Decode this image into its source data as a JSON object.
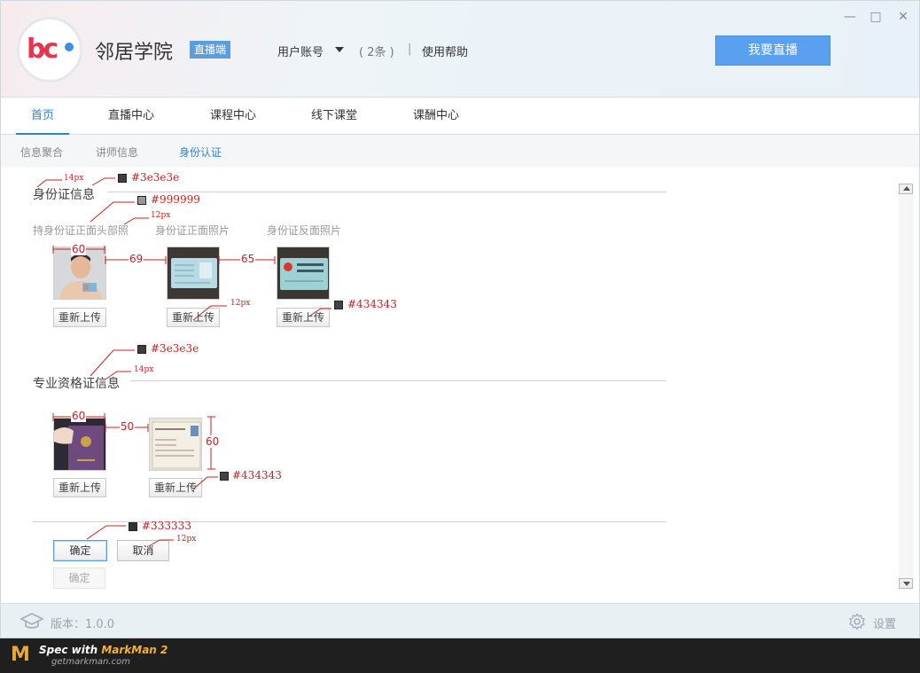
{
  "app": {
    "name": "邻居学院",
    "badge": "直播端",
    "account_label": "用户账号",
    "count": "( 2条 )",
    "separator": "|",
    "help": "使用帮助",
    "live_button": "我要直播",
    "window_controls": {
      "minimize": "—",
      "maximize": "□",
      "close": "✕"
    },
    "logo_text": "bc"
  },
  "tabs": [
    {
      "label": "首页",
      "active": true
    },
    {
      "label": "直播中心",
      "active": false
    },
    {
      "label": "课程中心",
      "active": false
    },
    {
      "label": "线下课堂",
      "active": false
    },
    {
      "label": "课酬中心",
      "active": false
    }
  ],
  "subtabs": [
    {
      "label": "信息聚合",
      "active": false
    },
    {
      "label": "讲师信息",
      "active": false
    },
    {
      "label": "身份认证",
      "active": true
    }
  ],
  "identity": {
    "title": "身份证信息",
    "photos": [
      {
        "label": "持身份证正面头部照",
        "button": "重新上传"
      },
      {
        "label": "身份证正面照片",
        "button": "重新上传"
      },
      {
        "label": "身份证反面照片",
        "button": "重新上传"
      }
    ]
  },
  "qualification": {
    "title": "专业资格证信息",
    "photos": [
      {
        "button": "重新上传"
      },
      {
        "button": "重新上传"
      }
    ]
  },
  "actions": {
    "confirm": "确定",
    "cancel": "取消",
    "confirm_disabled": "确定"
  },
  "footer": {
    "version": "版本：1.0.0",
    "settings": "设置"
  },
  "markman": {
    "logo": "M",
    "title_prefix": "Spec with ",
    "title_brand": "MarkMan 2",
    "url": "getmarkman.com"
  },
  "annotations": {
    "color_title": "#3e3e3e",
    "size_title": "14px",
    "color_label": "#999999",
    "size_label": "12px",
    "color_button": "#434343",
    "size_button": "12px",
    "dim_width": "60",
    "gap_1": "69",
    "gap_2": "65",
    "color_title_2": "#3e3e3e",
    "size_title_2": "14px",
    "dim_width_2": "60",
    "gap_3": "50",
    "dim_height": "60",
    "color_button_2": "#434343",
    "color_action": "#333333",
    "size_action": "12px"
  },
  "colors": {
    "accent": "#2a85d8",
    "live_button": "#5aa0f0",
    "badge": "#5a9ee0",
    "annotation": "#cc1f1f"
  }
}
